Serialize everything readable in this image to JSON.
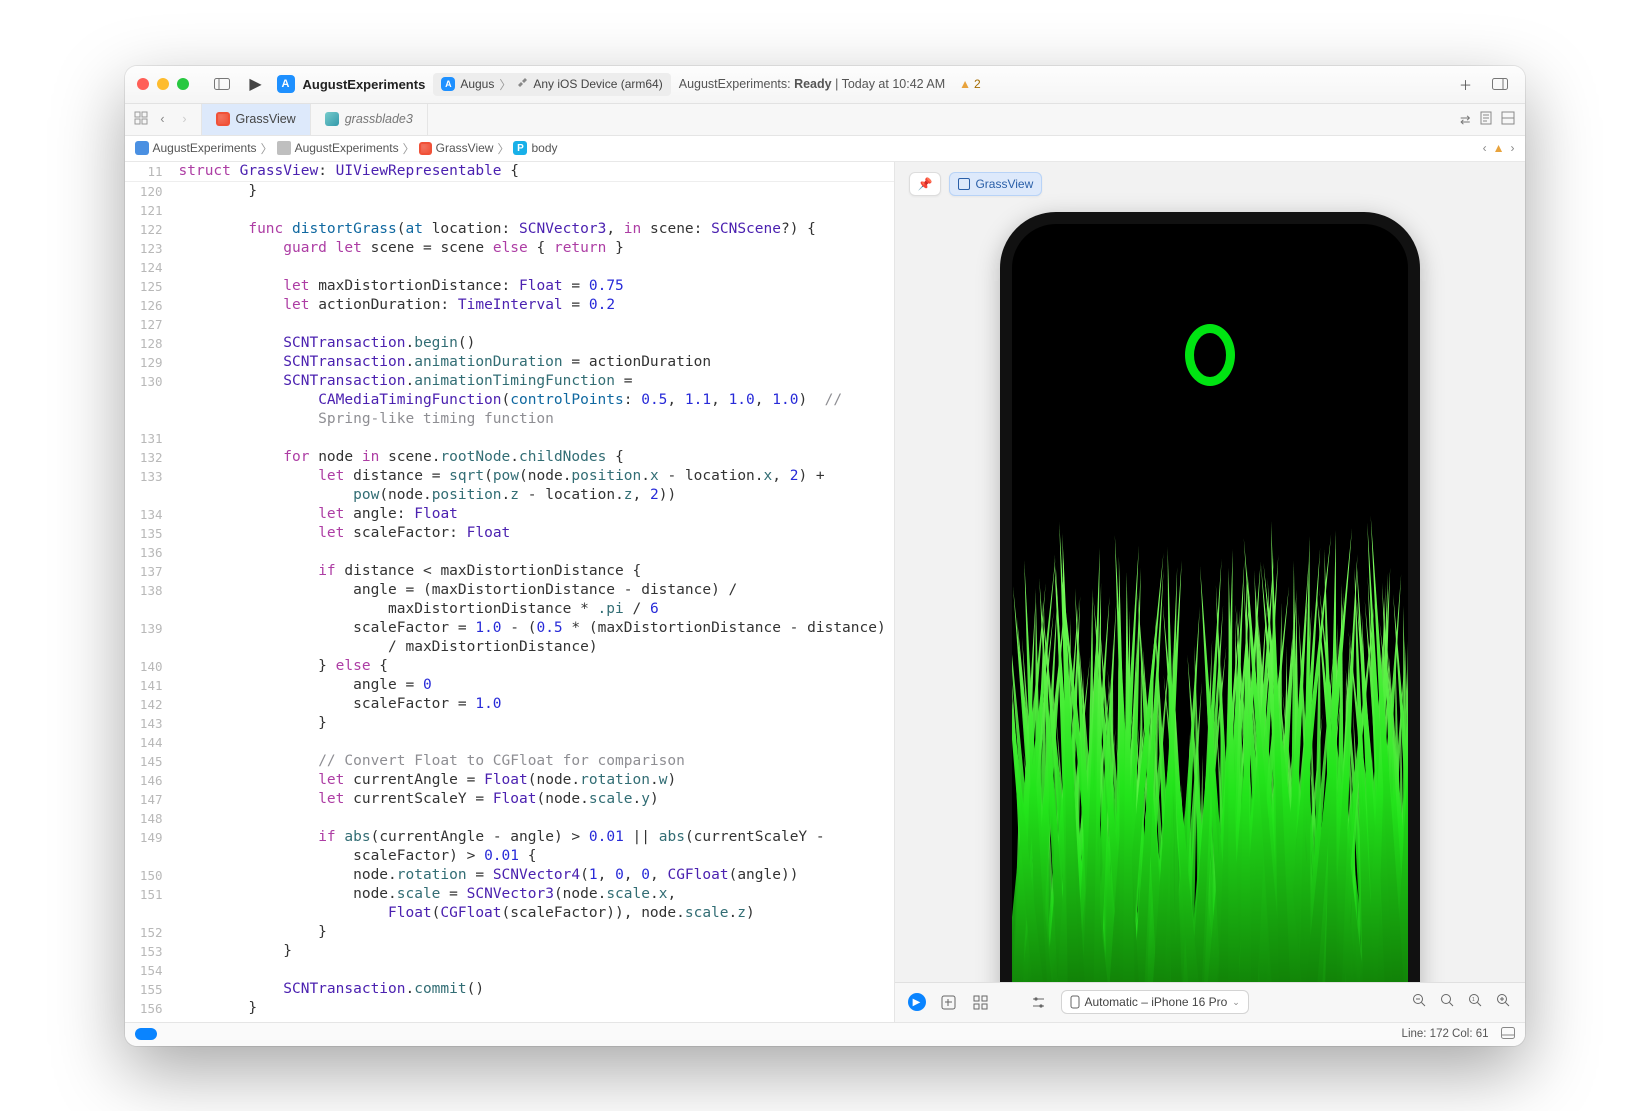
{
  "titlebar": {
    "project": "AugustExperiments",
    "scheme_app": "Augus",
    "scheme_dest": "Any iOS Device (arm64)",
    "status_prefix": "AugustExperiments:",
    "status_word": "Ready",
    "status_time": "| Today at 10:42 AM",
    "warning_count": "2"
  },
  "tabs": {
    "active": "GrassView",
    "second": "grassblade3"
  },
  "breadcrumb": {
    "c1": "AugustExperiments",
    "c2": "AugustExperiments",
    "c3": "GrassView",
    "c4": "body"
  },
  "preview": {
    "chip": "GrassView",
    "device": "Automatic – iPhone 16 Pro"
  },
  "statusbar": {
    "pos": "Line: 172  Col: 61"
  },
  "code": {
    "pin_num": "11",
    "l120": "120",
    "l121": "121",
    "l122": "122",
    "l123": "123",
    "l124": "124",
    "l125": "125",
    "l126": "126",
    "l127": "127",
    "l128": "128",
    "l129": "129",
    "l130": "130",
    "l131": "131",
    "l132": "132",
    "l133": "133",
    "l134": "134",
    "l135": "135",
    "l136": "136",
    "l137": "137",
    "l138": "138",
    "l139": "139",
    "l140": "140",
    "l141": "141",
    "l142": "142",
    "l143": "143",
    "l144": "144",
    "l145": "145",
    "l146": "146",
    "l147": "147",
    "l148": "148",
    "l149": "149",
    "l150": "150",
    "l151": "151",
    "l152": "152",
    "l153": "153",
    "l154": "154",
    "l155": "155",
    "l156": "156",
    "struct_kw": "struct",
    "struct_name": "GrassView",
    "uivr": "UIViewRepresentable",
    "func_kw": "func",
    "distort": "distortGrass",
    "at_lbl": "at",
    "loc": "location",
    "scnv3": "SCNVector3",
    "in_lbl": "in",
    "scene": "scene",
    "scnscene": "SCNScene",
    "guard_kw": "guard",
    "let_kw": "let",
    "else_kw": "else",
    "return_kw": "return",
    "mdd": "maxDistortionDistance",
    "float_t": "Float",
    "n075": "0.75",
    "ad": "actionDuration",
    "ti": "TimeInterval",
    "n02": "0.2",
    "scntx": "SCNTransaction",
    "begin": "begin",
    "animd": "animationDuration",
    "animtf": "animationTimingFunction",
    "camf": "CAMediaTimingFunction",
    "cp": "controlPoints",
    "n05": "0.5",
    "n11": "1.1",
    "n10": "1.0",
    "cmt_spring": "// Spring-like timing function",
    "for_kw": "for",
    "node": "node",
    "in_kw": "in",
    "rootNode": "rootNode",
    "childNodes": "childNodes",
    "dist": "distance",
    "sqrt": "sqrt",
    "pow": "pow",
    "position": "position",
    "x": "x",
    "z": "z",
    "two": "2",
    "angle": "angle",
    "sf": "scaleFactor",
    "if_kw": "if",
    "pi": ".pi",
    "six": "6",
    "zero": "0",
    "cmt_conv": "// Convert Float to CGFloat for comparison",
    "ca": "currentAngle",
    "rotation": "rotation",
    "w": "w",
    "csy": "currentScaleY",
    "scale": "scale",
    "y": "y",
    "abs": "abs",
    "n001": "0.01",
    "or": "||",
    "scnv4": "SCNVector4",
    "one": "1",
    "cgfloat": "CGFloat",
    "commit": "commit"
  }
}
